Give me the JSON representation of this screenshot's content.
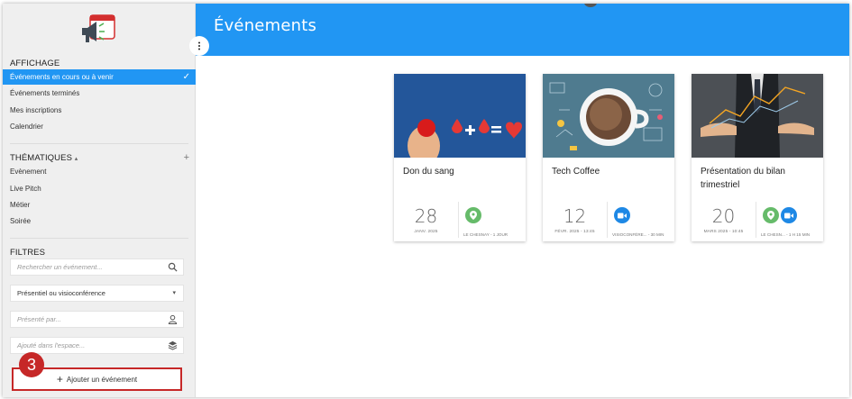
{
  "header": {
    "title": "Événements"
  },
  "sidebar": {
    "affichage_title": "AFFICHAGE",
    "affichage_items": [
      {
        "label": "Événements en cours ou à venir",
        "active": true
      },
      {
        "label": "Événements terminés"
      },
      {
        "label": "Mes inscriptions"
      },
      {
        "label": "Calendrier"
      }
    ],
    "thematiques_title": "THÉMATIQUES",
    "thematiques_caret": "▴",
    "thematiques_add": "+",
    "thematiques_items": [
      {
        "label": "Evènement"
      },
      {
        "label": "Live Pitch"
      },
      {
        "label": "Métier"
      },
      {
        "label": "Soirée"
      }
    ],
    "filtres_title": "FILTRES",
    "filters": {
      "search_placeholder": "Rechercher un événement...",
      "mode_value": "Présentiel ou visioconférence",
      "presenter_placeholder": "Présenté par...",
      "space_placeholder": "Ajouté dans l'espace..."
    },
    "add_button_label": "Ajouter un événement",
    "add_button_plus": "+",
    "step_number": "3"
  },
  "events": [
    {
      "title": "Don du sang",
      "day": "28",
      "month": "JANV. 2025",
      "location": "LE CHESNAY - 1 JOUR",
      "icons": [
        "location-pin-icon"
      ]
    },
    {
      "title": "Tech Coffee",
      "day": "12",
      "month": "FÉVR. 2025 - 13:45",
      "location": "VISIOCONFÉRE... - 30 MIN",
      "icons": [
        "video-camera-icon"
      ]
    },
    {
      "title": "Présentation du bilan trimestriel",
      "day": "20",
      "month": "MARS 2025 - 10:45",
      "location": "LE CHESN... - 1 H 15 MIN",
      "icons": [
        "location-pin-icon",
        "video-camera-icon"
      ]
    }
  ],
  "colors": {
    "accent": "#2196f3",
    "highlight": "#c62828",
    "green": "#66bb6a",
    "blue": "#1e88e5"
  }
}
